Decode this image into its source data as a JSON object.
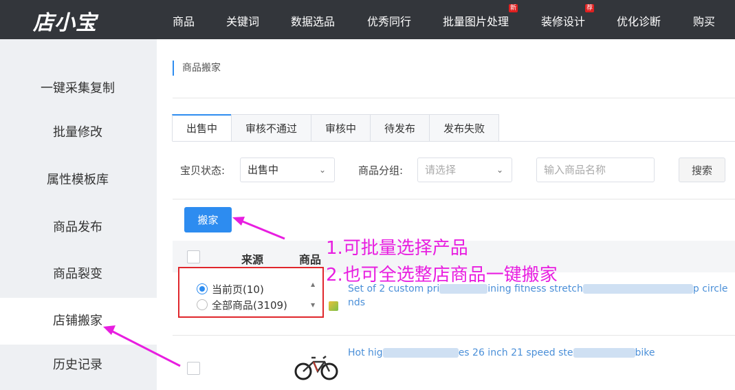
{
  "brand": {
    "logo_text": "店小宝"
  },
  "nav": {
    "items": [
      {
        "label": "商品",
        "badge": ""
      },
      {
        "label": "关键词",
        "badge": ""
      },
      {
        "label": "数据选品",
        "badge": ""
      },
      {
        "label": "优秀同行",
        "badge": ""
      },
      {
        "label": "批量图片处理",
        "badge": "新"
      },
      {
        "label": "装修设计",
        "badge": "荐"
      },
      {
        "label": "优化诊断",
        "badge": ""
      },
      {
        "label": "购买",
        "badge": ""
      }
    ]
  },
  "sidebar": {
    "items": [
      {
        "label": "一键采集复制"
      },
      {
        "label": "批量修改"
      },
      {
        "label": "属性模板库"
      },
      {
        "label": "商品发布"
      },
      {
        "label": "商品裂变"
      },
      {
        "label": "店铺搬家"
      },
      {
        "label": "历史记录"
      }
    ],
    "active": "店铺搬家"
  },
  "breadcrumb": "商品搬家",
  "tabs": [
    {
      "label": "出售中"
    },
    {
      "label": "审核不通过"
    },
    {
      "label": "审核中"
    },
    {
      "label": "待发布"
    },
    {
      "label": "发布失败"
    }
  ],
  "filters": {
    "status_label": "宝贝状态:",
    "status_value": "出售中",
    "group_label": "商品分组:",
    "group_placeholder": "请选择",
    "name_placeholder": "输入商品名称",
    "search_label": "搜索"
  },
  "move_button": "搬家",
  "table": {
    "columns": [
      "来源",
      "商品"
    ],
    "rows": [
      {
        "title_start": "Set of 2 custom pri",
        "title_mid": "ining fitness stretch",
        "title_end": "p circle",
        "title_line2": "nds"
      },
      {
        "title_start": "Hot hig",
        "title_mid": "es 26 inch 21 speed ste",
        "title_end": "bike"
      }
    ]
  },
  "selection_dropdown": {
    "options": [
      {
        "label": "当前页(10)",
        "selected": true
      },
      {
        "label": "全部商品(3109)",
        "selected": false
      }
    ]
  },
  "annotations": {
    "line1": "1.可批量选择产品",
    "line2": "2.也可全选整店商品一键搬家"
  },
  "colors": {
    "accent": "#2d8cf0",
    "annotation": "#e81ee0",
    "highlight_box": "#e0262b",
    "nav_bg": "#33363b"
  }
}
